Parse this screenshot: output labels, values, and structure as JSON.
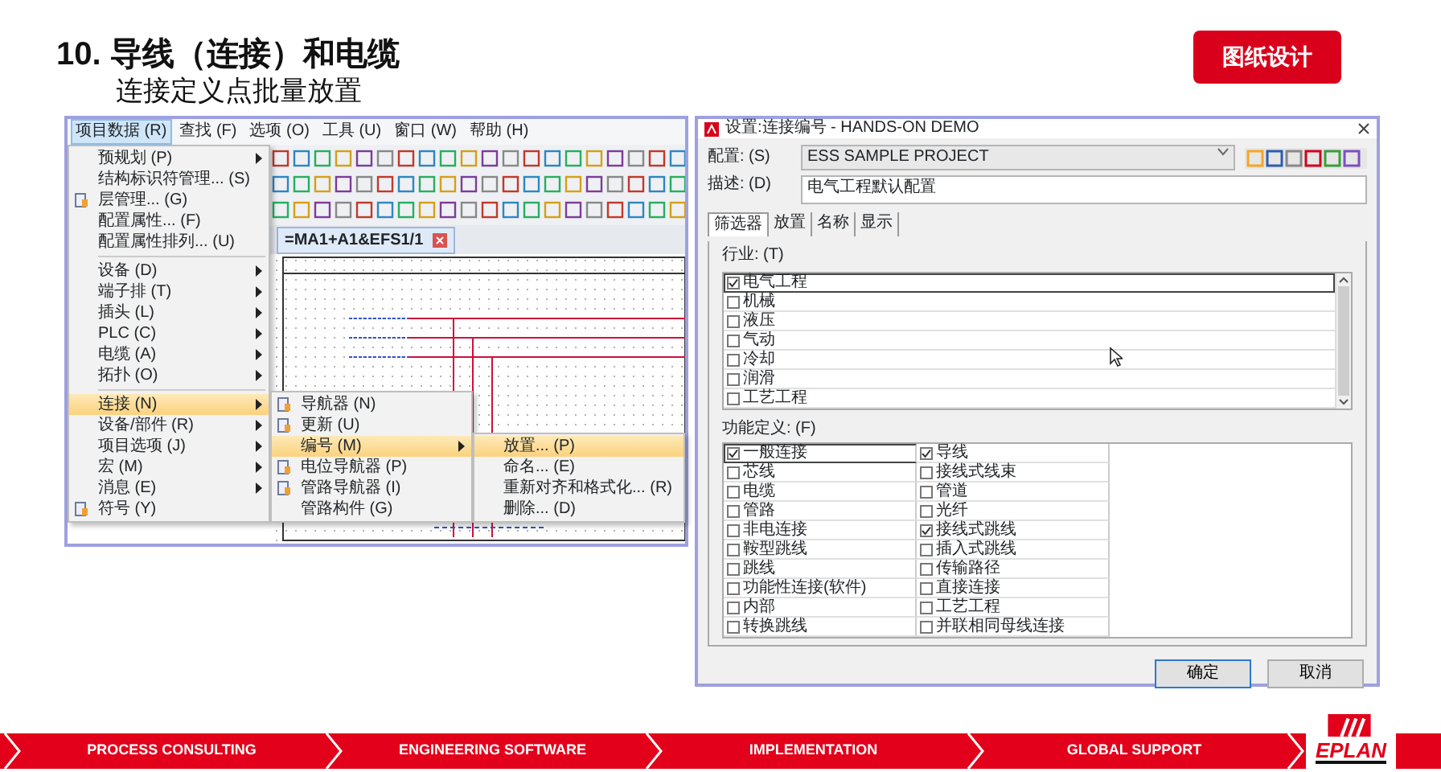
{
  "title": "10. 导线（连接）和电缆",
  "subtitle": "连接定义点批量放置",
  "section_badge": "图纸设计",
  "app": {
    "menu_bar": [
      {
        "label": "项目数据 (R)",
        "selected": true
      },
      {
        "label": "查找 (F)",
        "selected": false
      },
      {
        "label": "选项 (O)",
        "selected": false
      },
      {
        "label": "工具 (U)",
        "selected": false
      },
      {
        "label": "窗口 (W)",
        "selected": false
      },
      {
        "label": "帮助 (H)",
        "selected": false
      }
    ],
    "document_tab": "=MA1+A1&EFS1/1",
    "menu_sections": [
      [
        {
          "label": "预规划 (P)",
          "has_submenu": true,
          "selected": false,
          "icon": false
        },
        {
          "label": "结构标识符管理... (S)",
          "has_submenu": false,
          "selected": false,
          "icon": false
        },
        {
          "label": "层管理... (G)",
          "has_submenu": false,
          "selected": false,
          "icon": true
        },
        {
          "label": "配置属性... (F)",
          "has_submenu": false,
          "selected": false,
          "icon": false
        },
        {
          "label": "配置属性排列... (U)",
          "has_submenu": false,
          "selected": false,
          "icon": false
        }
      ],
      [
        {
          "label": "设备 (D)",
          "has_submenu": true,
          "selected": false,
          "icon": false
        },
        {
          "label": "端子排 (T)",
          "has_submenu": true,
          "selected": false,
          "icon": false
        },
        {
          "label": "插头 (L)",
          "has_submenu": true,
          "selected": false,
          "icon": false
        },
        {
          "label": "PLC (C)",
          "has_submenu": true,
          "selected": false,
          "icon": false
        },
        {
          "label": "电缆 (A)",
          "has_submenu": true,
          "selected": false,
          "icon": false
        },
        {
          "label": "拓扑 (O)",
          "has_submenu": true,
          "selected": false,
          "icon": false
        }
      ],
      [
        {
          "label": "连接 (N)",
          "has_submenu": true,
          "selected": true,
          "icon": false
        },
        {
          "label": "设备/部件 (R)",
          "has_submenu": true,
          "selected": false,
          "icon": false
        },
        {
          "label": "项目选项 (J)",
          "has_submenu": true,
          "selected": false,
          "icon": false
        },
        {
          "label": "宏 (M)",
          "has_submenu": true,
          "selected": false,
          "icon": false
        },
        {
          "label": "消息 (E)",
          "has_submenu": true,
          "selected": false,
          "icon": false
        },
        {
          "label": "符号 (Y)",
          "has_submenu": false,
          "selected": false,
          "icon": true
        }
      ]
    ],
    "submenu": [
      {
        "label": "导航器 (N)",
        "has_submenu": false,
        "selected": false,
        "icon": true
      },
      {
        "label": "更新 (U)",
        "has_submenu": false,
        "selected": false,
        "icon": true
      },
      {
        "label": "编号 (M)",
        "has_submenu": true,
        "selected": true,
        "icon": false
      },
      {
        "label": "电位导航器 (P)",
        "has_submenu": false,
        "selected": false,
        "icon": true
      },
      {
        "label": "管路导航器 (I)",
        "has_submenu": false,
        "selected": false,
        "icon": true
      },
      {
        "label": "管路构件 (G)",
        "has_submenu": false,
        "selected": false,
        "icon": false
      }
    ],
    "submenu_2": [
      {
        "label": "放置... (P)",
        "selected": true
      },
      {
        "label": "命名... (E)",
        "selected": false
      },
      {
        "label": "重新对齐和格式化... (R)",
        "selected": false
      },
      {
        "label": "删除... (D)",
        "selected": false
      }
    ]
  },
  "dialog": {
    "title": "设置:连接编号 - HANDS-ON DEMO",
    "config_label": "配置: (S)",
    "config_value": "ESS SAMPLE PROJECT",
    "description_label": "描述: (D)",
    "description_value": "电气工程默认配置",
    "tabs": [
      {
        "label": "筛选器",
        "selected": true
      },
      {
        "label": "放置",
        "selected": false
      },
      {
        "label": "名称",
        "selected": false
      },
      {
        "label": "显示",
        "selected": false
      }
    ],
    "industry_label": "行业: (T)",
    "industries": [
      {
        "label": "电气工程",
        "checked": true
      },
      {
        "label": "机械",
        "checked": false
      },
      {
        "label": "液压",
        "checked": false
      },
      {
        "label": "气动",
        "checked": false
      },
      {
        "label": "冷却",
        "checked": false
      },
      {
        "label": "润滑",
        "checked": false
      },
      {
        "label": "工艺工程",
        "checked": false
      }
    ],
    "function_label": "功能定义: (F)",
    "functions": [
      {
        "label": "一般连接",
        "checked": true
      },
      {
        "label": "导线",
        "checked": true
      },
      {
        "label": "芯线",
        "checked": false
      },
      {
        "label": "接线式线束",
        "checked": false
      },
      {
        "label": "电缆",
        "checked": false
      },
      {
        "label": "管道",
        "checked": false
      },
      {
        "label": "管路",
        "checked": false
      },
      {
        "label": "光纤",
        "checked": false
      },
      {
        "label": "非电连接",
        "checked": false
      },
      {
        "label": "接线式跳线",
        "checked": true
      },
      {
        "label": "鞍型跳线",
        "checked": false
      },
      {
        "label": "插入式跳线",
        "checked": false
      },
      {
        "label": "跳线",
        "checked": false
      },
      {
        "label": "传输路径",
        "checked": false
      },
      {
        "label": "功能性连接(软件)",
        "checked": false
      },
      {
        "label": "直接连接",
        "checked": false
      },
      {
        "label": "内部",
        "checked": false
      },
      {
        "label": "工艺工程",
        "checked": false
      },
      {
        "label": "转换跳线",
        "checked": false
      },
      {
        "label": "并联相同母线连接",
        "checked": false
      }
    ],
    "buttons": [
      {
        "label": "确定",
        "default": true
      },
      {
        "label": "取消",
        "default": false
      }
    ]
  },
  "footer": {
    "items": [
      "PROCESS CONSULTING",
      "ENGINEERING SOFTWARE",
      "IMPLEMENTATION",
      "GLOBAL SUPPORT"
    ],
    "logo": "EPLAN"
  }
}
